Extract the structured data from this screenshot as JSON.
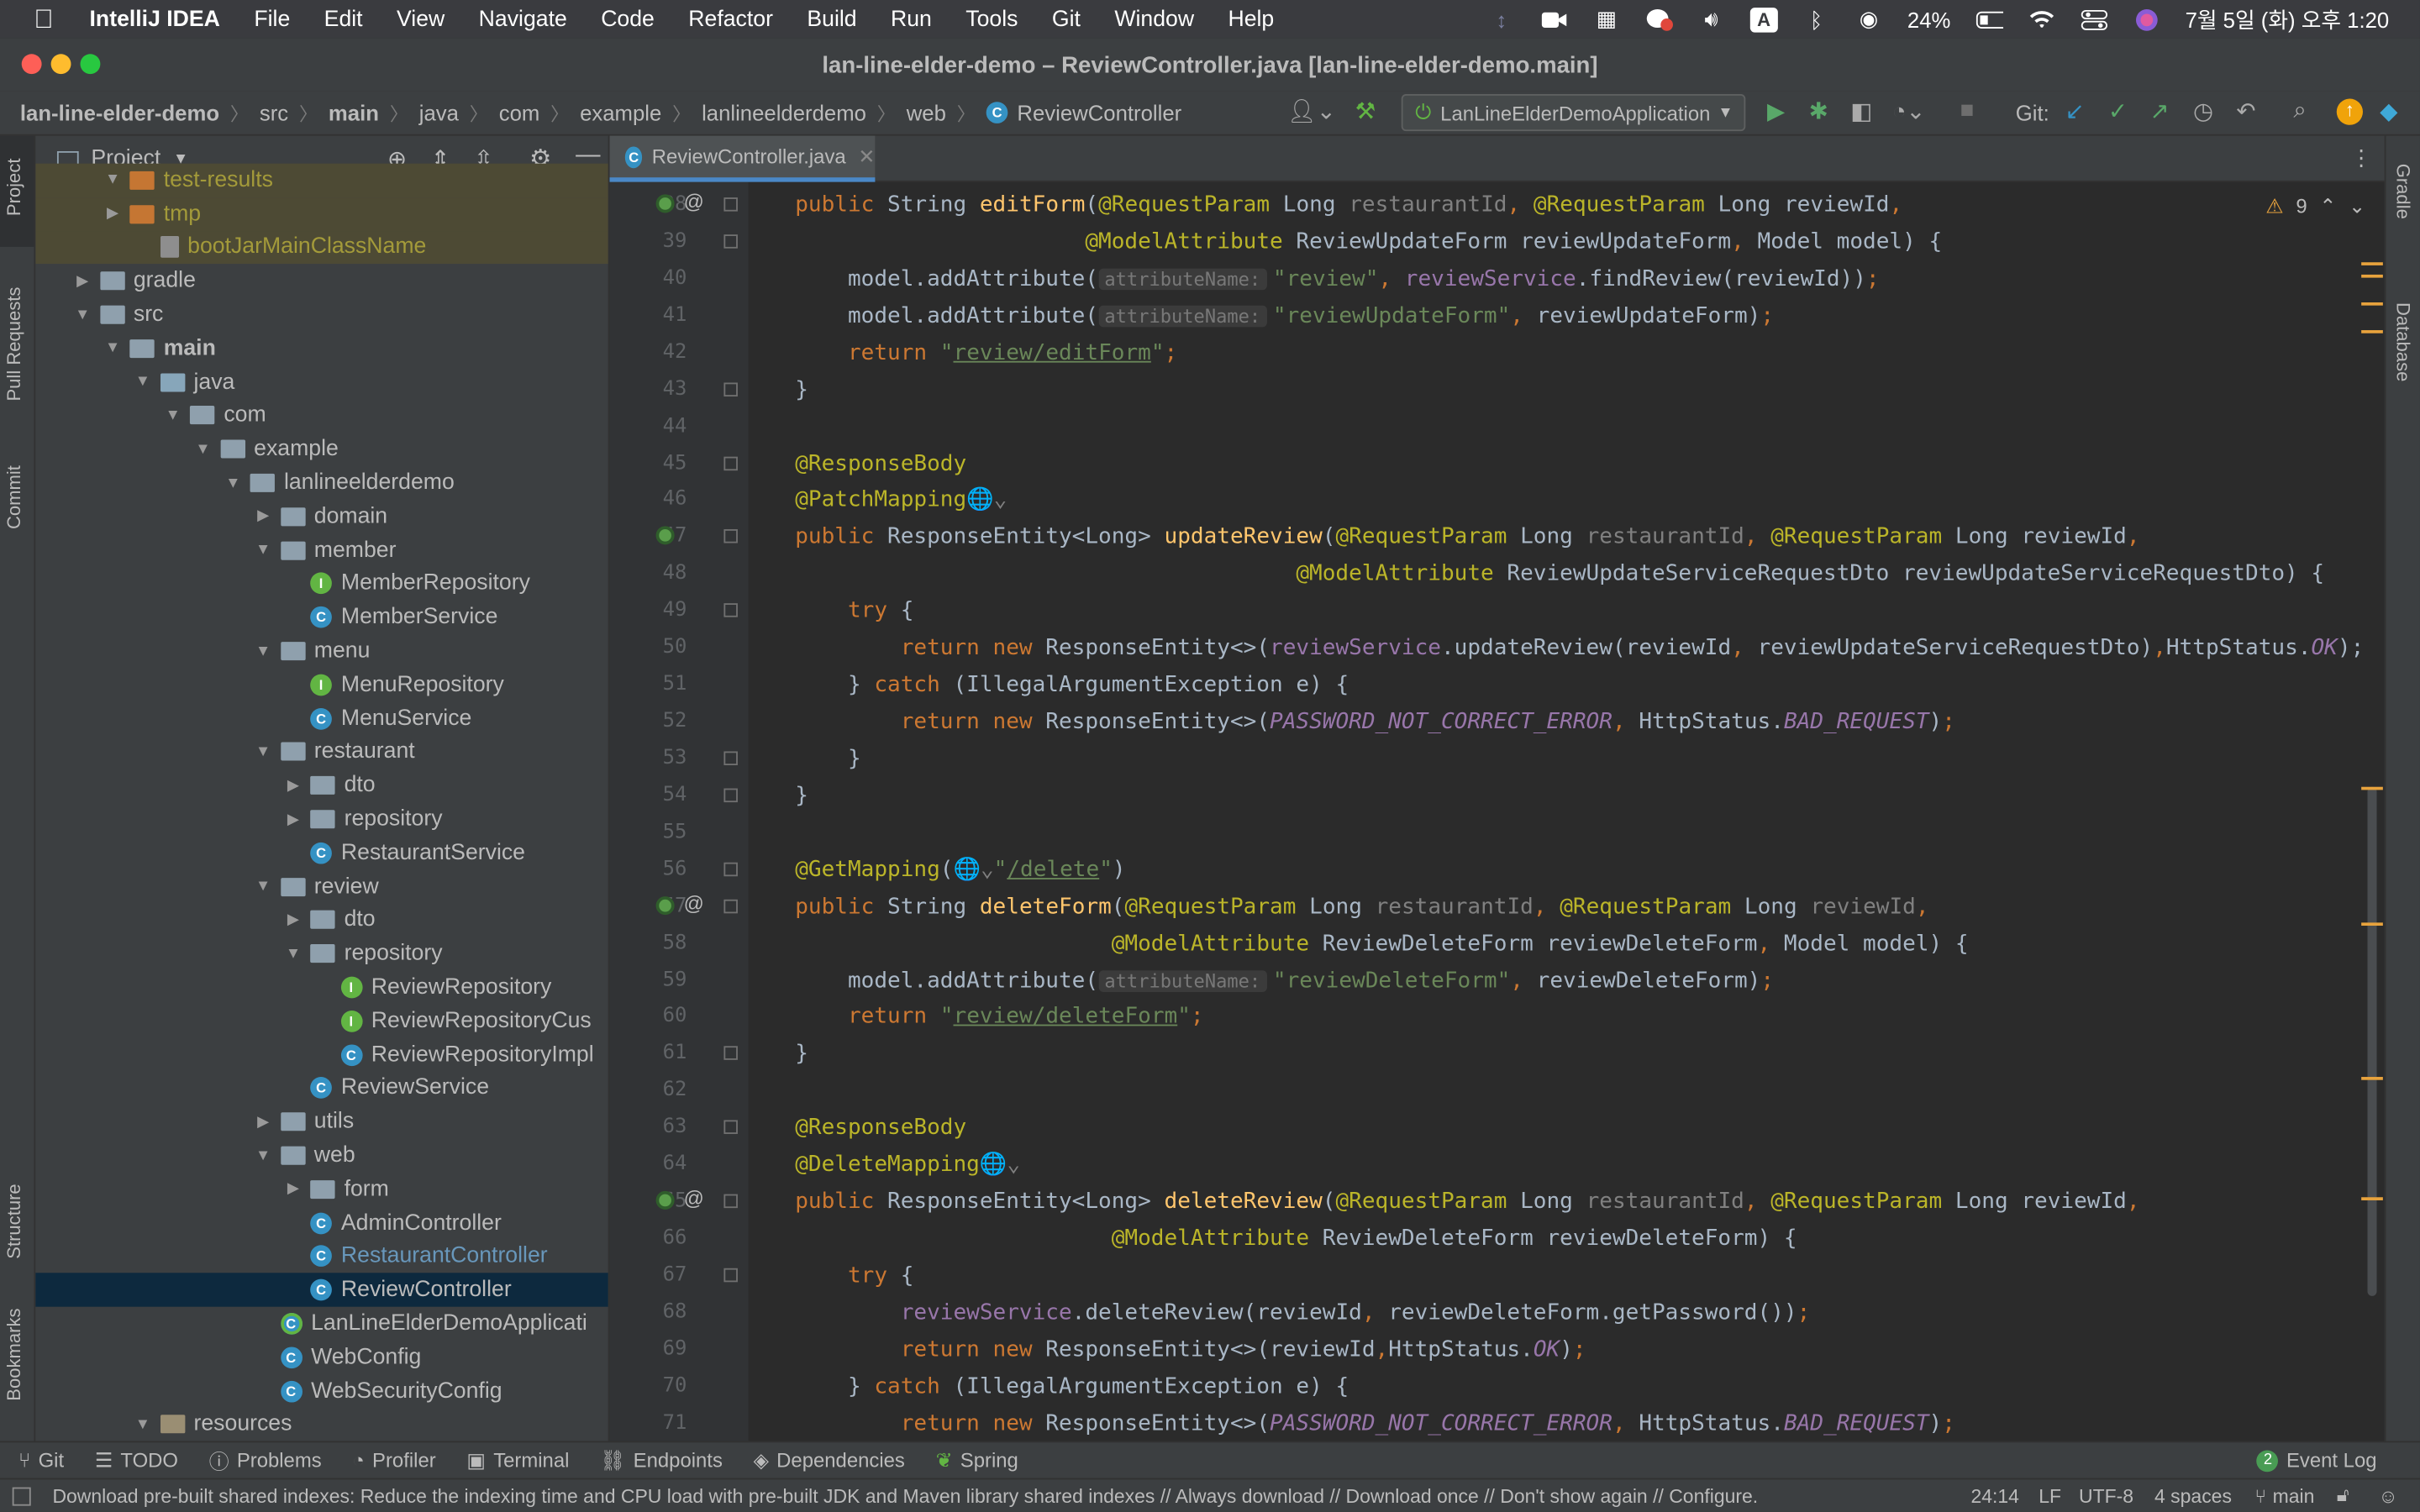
{
  "menubar": {
    "app": "IntelliJ IDEA",
    "items": [
      "File",
      "Edit",
      "View",
      "Navigate",
      "Code",
      "Refactor",
      "Build",
      "Run",
      "Tools",
      "Git",
      "Window",
      "Help"
    ],
    "battery": "24%",
    "clock": "7월 5일 (화) 오후 1:20",
    "input_method": "A"
  },
  "window": {
    "title": "lan-line-elder-demo – ReviewController.java [lan-line-elder-demo.main]"
  },
  "breadcrumbs": [
    "lan-line-elder-demo",
    "src",
    "main",
    "java",
    "com",
    "example",
    "lanlineelderdemo",
    "web",
    "ReviewController"
  ],
  "toolbar": {
    "run_config": "LanLineElderDemoApplication",
    "git_label": "Git:"
  },
  "left_stripe": {
    "project": "Project",
    "pull_requests": "Pull Requests",
    "commit": "Commit",
    "structure": "Structure",
    "bookmarks": "Bookmarks"
  },
  "right_stripe": {
    "gradle": "Gradle",
    "database": "Database"
  },
  "project": {
    "title": "Project",
    "tree": [
      {
        "label": "test-results",
        "depth": 2,
        "icon": "folder-orange",
        "arrow": "down"
      },
      {
        "label": "tmp",
        "depth": 2,
        "icon": "folder-orange",
        "arrow": "right"
      },
      {
        "label": "bootJarMainClassName",
        "depth": 3,
        "icon": "file"
      },
      {
        "label": "gradle",
        "depth": 1,
        "icon": "folder",
        "arrow": "right"
      },
      {
        "label": "src",
        "depth": 1,
        "icon": "folder",
        "arrow": "down"
      },
      {
        "label": "main",
        "depth": 2,
        "icon": "folder",
        "arrow": "down",
        "bold": true
      },
      {
        "label": "java",
        "depth": 3,
        "icon": "folder-src",
        "arrow": "down"
      },
      {
        "label": "com",
        "depth": 4,
        "icon": "folder",
        "arrow": "down"
      },
      {
        "label": "example",
        "depth": 5,
        "icon": "folder",
        "arrow": "down"
      },
      {
        "label": "lanlineelderdemo",
        "depth": 6,
        "icon": "folder",
        "arrow": "down"
      },
      {
        "label": "domain",
        "depth": 7,
        "icon": "folder",
        "arrow": "right"
      },
      {
        "label": "member",
        "depth": 7,
        "icon": "folder",
        "arrow": "down"
      },
      {
        "label": "MemberRepository",
        "depth": 8,
        "icon": "interface"
      },
      {
        "label": "MemberService",
        "depth": 8,
        "icon": "class"
      },
      {
        "label": "menu",
        "depth": 7,
        "icon": "folder",
        "arrow": "down"
      },
      {
        "label": "MenuRepository",
        "depth": 8,
        "icon": "interface"
      },
      {
        "label": "MenuService",
        "depth": 8,
        "icon": "class"
      },
      {
        "label": "restaurant",
        "depth": 7,
        "icon": "folder",
        "arrow": "down"
      },
      {
        "label": "dto",
        "depth": 8,
        "icon": "folder",
        "arrow": "right"
      },
      {
        "label": "repository",
        "depth": 8,
        "icon": "folder",
        "arrow": "right"
      },
      {
        "label": "RestaurantService",
        "depth": 8,
        "icon": "class"
      },
      {
        "label": "review",
        "depth": 7,
        "icon": "folder",
        "arrow": "down"
      },
      {
        "label": "dto",
        "depth": 8,
        "icon": "folder",
        "arrow": "right"
      },
      {
        "label": "repository",
        "depth": 8,
        "icon": "folder",
        "arrow": "down"
      },
      {
        "label": "ReviewRepository",
        "depth": 9,
        "icon": "interface"
      },
      {
        "label": "ReviewRepositoryCus",
        "depth": 9,
        "icon": "interface"
      },
      {
        "label": "ReviewRepositoryImpl",
        "depth": 9,
        "icon": "class"
      },
      {
        "label": "ReviewService",
        "depth": 8,
        "icon": "class"
      },
      {
        "label": "utils",
        "depth": 7,
        "icon": "folder",
        "arrow": "right"
      },
      {
        "label": "web",
        "depth": 7,
        "icon": "folder",
        "arrow": "down"
      },
      {
        "label": "form",
        "depth": 8,
        "icon": "folder",
        "arrow": "right"
      },
      {
        "label": "AdminController",
        "depth": 8,
        "icon": "class"
      },
      {
        "label": "RestaurantController",
        "depth": 8,
        "icon": "class",
        "modified": true
      },
      {
        "label": "ReviewController",
        "depth": 8,
        "icon": "class",
        "selected": true
      },
      {
        "label": "LanLineElderDemoApplicati",
        "depth": 7,
        "icon": "spring"
      },
      {
        "label": "WebConfig",
        "depth": 7,
        "icon": "class"
      },
      {
        "label": "WebSecurityConfig",
        "depth": 7,
        "icon": "class"
      },
      {
        "label": "resources",
        "depth": 3,
        "icon": "folder-res",
        "arrow": "down"
      }
    ]
  },
  "editor": {
    "tab": "ReviewController.java",
    "warnings": "9",
    "lines": [
      {
        "n": "38",
        "g": "bean-at",
        "t": [
          [
            "    ",
            ""
          ],
          [
            "public ",
            "kw"
          ],
          [
            "String ",
            ""
          ],
          [
            "editForm",
            "fn"
          ],
          [
            "(",
            ""
          ],
          [
            "@RequestParam ",
            "an"
          ],
          [
            "Long ",
            ""
          ],
          [
            "restaurantId",
            "gr"
          ],
          [
            ", ",
            "kw"
          ],
          [
            "@RequestParam ",
            "an"
          ],
          [
            "Long reviewId",
            ""
          ],
          [
            ",",
            "kw"
          ]
        ]
      },
      {
        "n": "39",
        "g": "fold",
        "t": [
          [
            "                          ",
            ""
          ],
          [
            "@ModelAttribute ",
            "an"
          ],
          [
            "ReviewUpdateForm reviewUpdateForm",
            ""
          ],
          [
            ", ",
            "kw"
          ],
          [
            "Model model) {",
            ""
          ]
        ]
      },
      {
        "n": "40",
        "t": [
          [
            "        model.addAttribute(",
            ""
          ],
          [
            "attributeName:",
            "hint"
          ],
          [
            "\"review\"",
            "st"
          ],
          [
            ", ",
            "kw"
          ],
          [
            "reviewService",
            "pu"
          ],
          [
            ".findReview(reviewId))",
            ""
          ],
          [
            ";",
            "kw"
          ]
        ]
      },
      {
        "n": "41",
        "t": [
          [
            "        model.addAttribute(",
            ""
          ],
          [
            "attributeName:",
            "hint"
          ],
          [
            "\"reviewUpdateForm\"",
            "st"
          ],
          [
            ", ",
            "kw"
          ],
          [
            "reviewUpdateForm)",
            ""
          ],
          [
            ";",
            "kw"
          ]
        ]
      },
      {
        "n": "42",
        "t": [
          [
            "        ",
            ""
          ],
          [
            "return ",
            "kw"
          ],
          [
            "\"",
            "st"
          ],
          [
            "review/editForm",
            "st ul"
          ],
          [
            "\"",
            "st"
          ],
          [
            ";",
            "kw"
          ]
        ]
      },
      {
        "n": "43",
        "g": "fold",
        "t": [
          [
            "    }",
            ""
          ]
        ]
      },
      {
        "n": "44",
        "t": []
      },
      {
        "n": "45",
        "g": "fold",
        "t": [
          [
            "    ",
            ""
          ],
          [
            "@ResponseBody",
            "an"
          ]
        ]
      },
      {
        "n": "46",
        "t": [
          [
            "    ",
            ""
          ],
          [
            "@PatchMapping",
            "an"
          ],
          [
            "🌐⌄",
            "gr"
          ]
        ]
      },
      {
        "n": "47",
        "g": "bean",
        "t": [
          [
            "    ",
            ""
          ],
          [
            "public ",
            "kw"
          ],
          [
            "ResponseEntity<Long> ",
            ""
          ],
          [
            "updateReview",
            "fn"
          ],
          [
            "(",
            ""
          ],
          [
            "@RequestParam ",
            "an"
          ],
          [
            "Long ",
            ""
          ],
          [
            "restaurantId",
            "gr"
          ],
          [
            ", ",
            "kw"
          ],
          [
            "@RequestParam ",
            "an"
          ],
          [
            "Long reviewId",
            ""
          ],
          [
            ",",
            "kw"
          ]
        ]
      },
      {
        "n": "48",
        "t": [
          [
            "                                          ",
            ""
          ],
          [
            "@ModelAttribute ",
            "an"
          ],
          [
            "ReviewUpdateServiceRequestDto reviewUpdateServiceRequestDto) {",
            ""
          ]
        ]
      },
      {
        "n": "49",
        "g": "fold",
        "t": [
          [
            "        ",
            ""
          ],
          [
            "try ",
            "kw"
          ],
          [
            "{",
            ""
          ]
        ]
      },
      {
        "n": "50",
        "t": [
          [
            "            ",
            ""
          ],
          [
            "return new ",
            "kw"
          ],
          [
            "ResponseEntity<>(",
            ""
          ],
          [
            "reviewService",
            "pu"
          ],
          [
            ".updateReview(reviewId",
            ""
          ],
          [
            ", ",
            "kw"
          ],
          [
            "reviewUpdateServiceRequestDto)",
            ""
          ],
          [
            ",",
            "kw"
          ],
          [
            "HttpStatus.",
            ""
          ],
          [
            "OK",
            "it"
          ],
          [
            ");",
            ""
          ]
        ]
      },
      {
        "n": "51",
        "t": [
          [
            "        } ",
            ""
          ],
          [
            "catch ",
            "kw"
          ],
          [
            "(IllegalArgumentException e) {",
            ""
          ]
        ]
      },
      {
        "n": "52",
        "t": [
          [
            "            ",
            ""
          ],
          [
            "return new ",
            "kw"
          ],
          [
            "ResponseEntity<>(",
            ""
          ],
          [
            "PASSWORD_NOT_CORRECT_ERROR",
            "it"
          ],
          [
            ", ",
            "kw"
          ],
          [
            "HttpStatus.",
            ""
          ],
          [
            "BAD_REQUEST",
            "it"
          ],
          [
            ")",
            ""
          ],
          [
            ";",
            "kw"
          ]
        ]
      },
      {
        "n": "53",
        "g": "fold",
        "t": [
          [
            "        }",
            ""
          ]
        ]
      },
      {
        "n": "54",
        "g": "fold",
        "t": [
          [
            "    }",
            ""
          ]
        ]
      },
      {
        "n": "55",
        "t": []
      },
      {
        "n": "56",
        "g": "fold",
        "t": [
          [
            "    ",
            ""
          ],
          [
            "@GetMapping",
            "an"
          ],
          [
            "(",
            ""
          ],
          [
            "🌐⌄",
            "gr"
          ],
          [
            "\"",
            "st"
          ],
          [
            "/delete",
            "st ul"
          ],
          [
            "\"",
            "st"
          ],
          [
            ")",
            ""
          ]
        ]
      },
      {
        "n": "57",
        "g": "bean-at",
        "t": [
          [
            "    ",
            ""
          ],
          [
            "public ",
            "kw"
          ],
          [
            "String ",
            ""
          ],
          [
            "deleteForm",
            "fn"
          ],
          [
            "(",
            ""
          ],
          [
            "@RequestParam ",
            "an"
          ],
          [
            "Long ",
            ""
          ],
          [
            "restaurantId",
            "gr"
          ],
          [
            ", ",
            "kw"
          ],
          [
            "@RequestParam ",
            "an"
          ],
          [
            "Long ",
            ""
          ],
          [
            "reviewId",
            "gr"
          ],
          [
            ",",
            "kw"
          ]
        ]
      },
      {
        "n": "58",
        "t": [
          [
            "                            ",
            ""
          ],
          [
            "@ModelAttribute ",
            "an"
          ],
          [
            "ReviewDeleteForm reviewDeleteForm",
            ""
          ],
          [
            ", ",
            "kw"
          ],
          [
            "Model model) {",
            ""
          ]
        ]
      },
      {
        "n": "59",
        "t": [
          [
            "        model.addAttribute(",
            ""
          ],
          [
            "attributeName:",
            "hint"
          ],
          [
            "\"reviewDeleteForm\"",
            "st"
          ],
          [
            ", ",
            "kw"
          ],
          [
            "reviewDeleteForm)",
            ""
          ],
          [
            ";",
            "kw"
          ]
        ]
      },
      {
        "n": "60",
        "t": [
          [
            "        ",
            ""
          ],
          [
            "return ",
            "kw"
          ],
          [
            "\"",
            "st"
          ],
          [
            "review/deleteForm",
            "st ul"
          ],
          [
            "\"",
            "st"
          ],
          [
            ";",
            "kw"
          ]
        ]
      },
      {
        "n": "61",
        "g": "fold",
        "t": [
          [
            "    }",
            ""
          ]
        ]
      },
      {
        "n": "62",
        "t": []
      },
      {
        "n": "63",
        "g": "fold",
        "t": [
          [
            "    ",
            ""
          ],
          [
            "@ResponseBody",
            "an"
          ]
        ]
      },
      {
        "n": "64",
        "t": [
          [
            "    ",
            ""
          ],
          [
            "@DeleteMapping",
            "an"
          ],
          [
            "🌐⌄",
            "gr"
          ]
        ]
      },
      {
        "n": "65",
        "g": "bean-at",
        "t": [
          [
            "    ",
            ""
          ],
          [
            "public ",
            "kw"
          ],
          [
            "ResponseEntity<Long> ",
            ""
          ],
          [
            "deleteReview",
            "fn"
          ],
          [
            "(",
            ""
          ],
          [
            "@RequestParam ",
            "an"
          ],
          [
            "Long ",
            ""
          ],
          [
            "restaurantId",
            "gr"
          ],
          [
            ", ",
            "kw"
          ],
          [
            "@RequestParam ",
            "an"
          ],
          [
            "Long reviewId",
            ""
          ],
          [
            ",",
            "kw"
          ]
        ]
      },
      {
        "n": "66",
        "t": [
          [
            "                            ",
            ""
          ],
          [
            "@ModelAttribute ",
            "an"
          ],
          [
            "ReviewDeleteForm reviewDeleteForm) {",
            ""
          ]
        ]
      },
      {
        "n": "67",
        "g": "fold",
        "t": [
          [
            "        ",
            ""
          ],
          [
            "try ",
            "kw"
          ],
          [
            "{",
            ""
          ]
        ]
      },
      {
        "n": "68",
        "t": [
          [
            "            ",
            ""
          ],
          [
            "reviewService",
            "pu"
          ],
          [
            ".deleteReview(reviewId",
            ""
          ],
          [
            ", ",
            "kw"
          ],
          [
            "reviewDeleteForm.getPassword())",
            ""
          ],
          [
            ";",
            "kw"
          ]
        ]
      },
      {
        "n": "69",
        "t": [
          [
            "            ",
            ""
          ],
          [
            "return new ",
            "kw"
          ],
          [
            "ResponseEntity<>(reviewId",
            ""
          ],
          [
            ",",
            "kw"
          ],
          [
            "HttpStatus.",
            ""
          ],
          [
            "OK",
            "it"
          ],
          [
            ")",
            ""
          ],
          [
            ";",
            "kw"
          ]
        ]
      },
      {
        "n": "70",
        "t": [
          [
            "        } ",
            ""
          ],
          [
            "catch ",
            "kw"
          ],
          [
            "(IllegalArgumentException e) {",
            ""
          ]
        ]
      },
      {
        "n": "71",
        "t": [
          [
            "            ",
            ""
          ],
          [
            "return new ",
            "kw"
          ],
          [
            "ResponseEntity<>(",
            ""
          ],
          [
            "PASSWORD_NOT_CORRECT_ERROR",
            "it"
          ],
          [
            ", ",
            "kw"
          ],
          [
            "HttpStatus.",
            ""
          ],
          [
            "BAD_REQUEST",
            "it"
          ],
          [
            ")",
            ""
          ],
          [
            ";",
            "kw"
          ]
        ]
      }
    ]
  },
  "tool_windows": [
    "Git",
    "TODO",
    "Problems",
    "Profiler",
    "Terminal",
    "Endpoints",
    "Dependencies",
    "Spring"
  ],
  "event_log": {
    "count": "2",
    "label": "Event Log"
  },
  "status": {
    "message": "Download pre-built shared indexes: Reduce the indexing time and CPU load with pre-built JDK and Maven library shared indexes // Always download // Download once // Don't show again // Configure...",
    "position": "24:14",
    "line_sep": "LF",
    "encoding": "UTF-8",
    "indent": "4 spaces",
    "branch": "main"
  }
}
